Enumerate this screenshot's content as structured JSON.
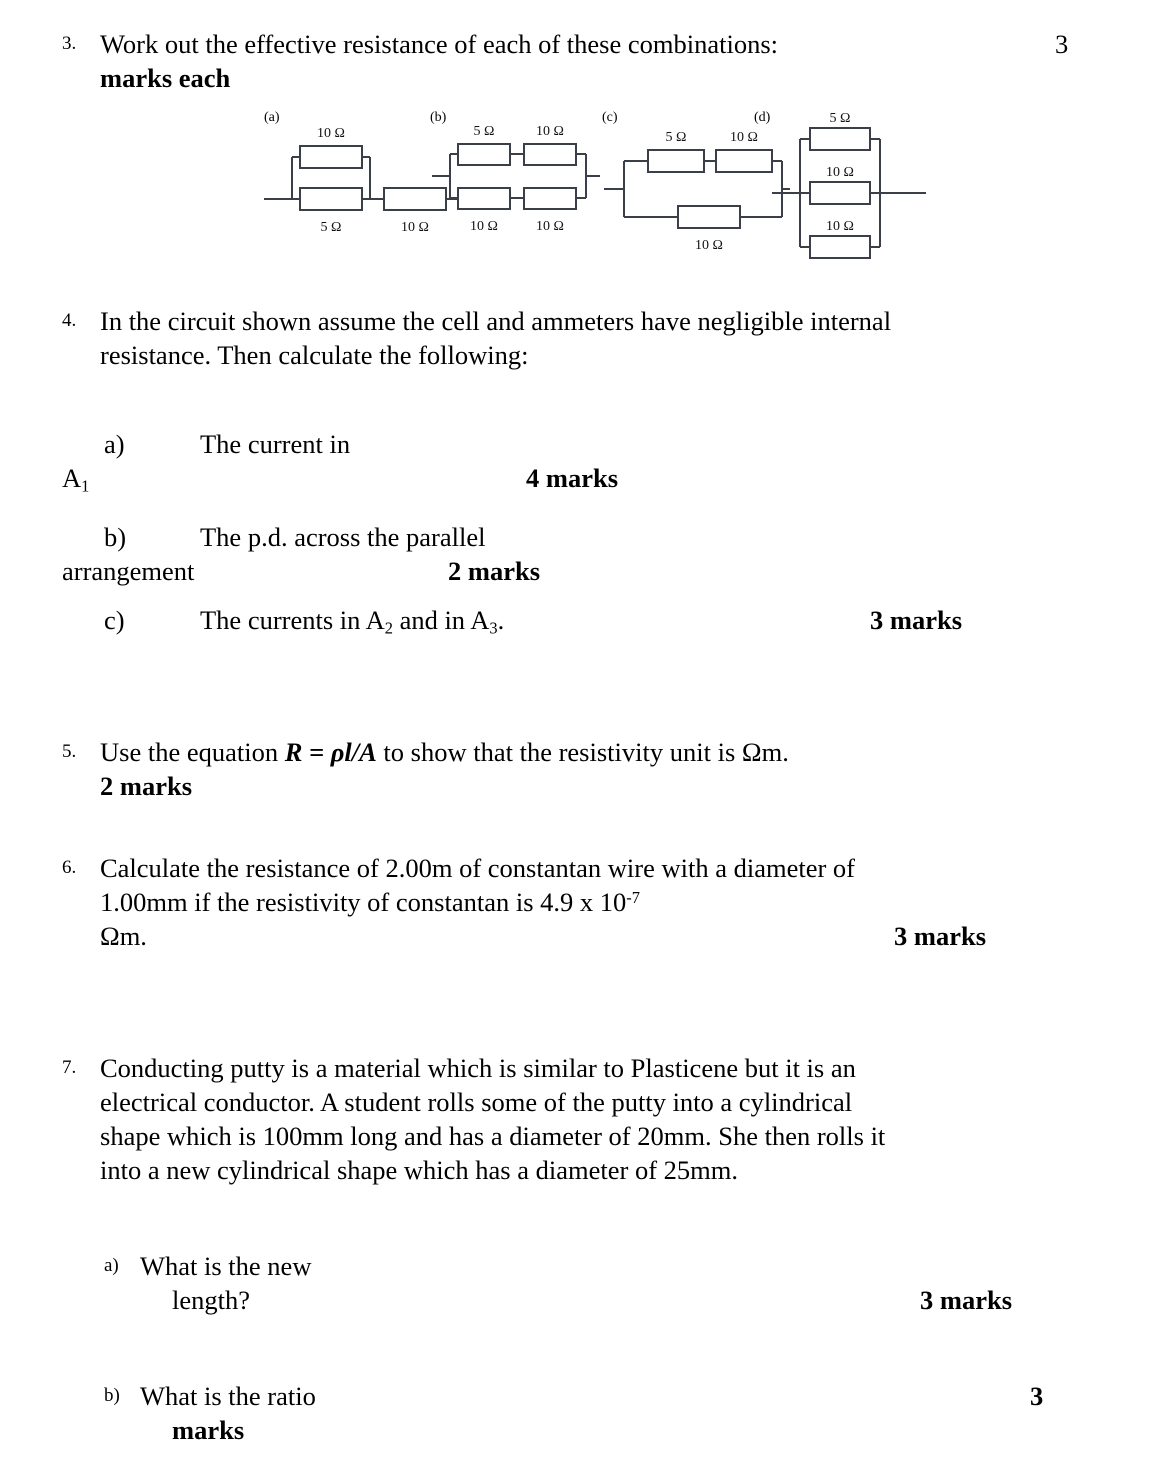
{
  "document": {
    "type": "physics-worksheet",
    "subject": "Resistance and Resistivity"
  },
  "q3": {
    "number": "3.",
    "text": "Work out the effective resistance of each of these combinations:",
    "marks_line1": "3",
    "marks_line2": "marks each"
  },
  "circuits": [
    {
      "label": "(a)",
      "name": "circuit-a",
      "description": "10 ohm in parallel with 5 ohm, in series with 10 ohm",
      "resistors": [
        {
          "value": "10 Ω",
          "position": "top-parallel"
        },
        {
          "value": "5 Ω",
          "position": "bottom-parallel"
        },
        {
          "value": "10 Ω",
          "position": "series-right"
        }
      ]
    },
    {
      "label": "(b)",
      "name": "circuit-b",
      "description": "Two series branches in parallel",
      "resistors": [
        {
          "value": "5 Ω",
          "position": "top-left"
        },
        {
          "value": "10 Ω",
          "position": "top-right"
        },
        {
          "value": "10 Ω",
          "position": "bottom-left"
        },
        {
          "value": "10 Ω",
          "position": "bottom-right"
        }
      ]
    },
    {
      "label": "(c)",
      "name": "circuit-c",
      "description": "5 ohm and 10 ohm in series, in parallel with 10 ohm",
      "resistors": [
        {
          "value": "5 Ω",
          "position": "top-left"
        },
        {
          "value": "10 Ω",
          "position": "top-right"
        },
        {
          "value": "10 Ω",
          "position": "bottom"
        }
      ]
    },
    {
      "label": "(d)",
      "name": "circuit-d",
      "description": "Three resistors in parallel",
      "resistors": [
        {
          "value": "5 Ω",
          "position": "top"
        },
        {
          "value": "10 Ω",
          "position": "middle"
        },
        {
          "value": "10 Ω",
          "position": "bottom"
        }
      ]
    }
  ],
  "q4": {
    "number": "4.",
    "text_line1": "In the circuit shown assume the cell and ammeters have negligible internal",
    "text_line2": "resistance. Then calculate the following:",
    "parts": [
      {
        "letter": "a)",
        "text_line1": "The current in",
        "text_line2": "A",
        "text_line2_sub": "1",
        "marks": "4  marks"
      },
      {
        "letter": "b)",
        "text_line1": "The p.d. across the parallel",
        "text_line2": "arrangement",
        "marks": "2  marks"
      },
      {
        "letter": "c)",
        "text_pre": "The currents in A",
        "sub1": "2",
        "text_mid": " and in A",
        "sub2": "3",
        "text_post": ".",
        "marks": "3  marks"
      }
    ]
  },
  "q5": {
    "number": "5.",
    "text_pre": "Use the equation ",
    "equation": "R = ρl/A",
    "text_post": " to show that the resistivity unit is Ωm.",
    "marks": "2 marks"
  },
  "q6": {
    "number": "6.",
    "text_line1": "Calculate the resistance of 2.00m of constantan wire with a diameter of",
    "text_line2_pre": "1.00mm if the resistivity of constantan is 4.9 x 10",
    "text_line2_sup": "-7",
    "text_line3": "Ωm.",
    "marks": "3 marks"
  },
  "q7": {
    "number": "7.",
    "text_line1": "Conducting putty is a material which is similar to Plasticene but it is an",
    "text_line2": "electrical conductor.   A student rolls some of the putty into a cylindrical",
    "text_line3": "shape which is 100mm long and has a diameter of 20mm. She then rolls it",
    "text_line4": "into a new cylindrical shape which has a diameter of 25mm.",
    "parts": [
      {
        "letter": "a)",
        "text_line1": "What is the new",
        "text_line2": "length?",
        "marks": "3 marks"
      },
      {
        "letter": "b)",
        "text_line1": "What is the ratio",
        "marks_line1": "3",
        "marks_line2": "marks"
      }
    ]
  }
}
